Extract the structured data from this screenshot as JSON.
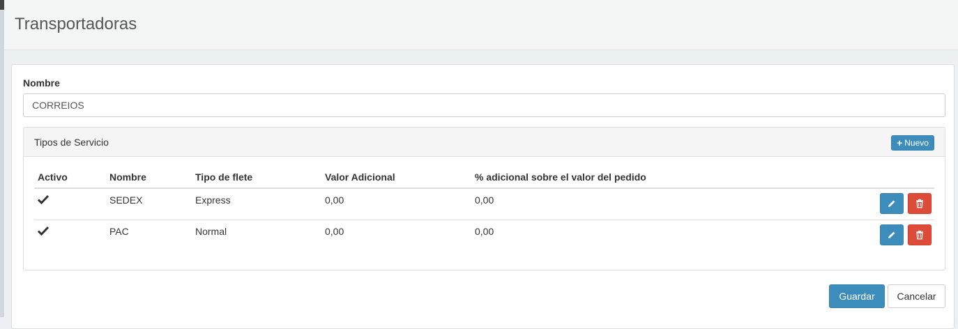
{
  "header": {
    "title": "Transportadoras"
  },
  "form": {
    "name_label": "Nombre",
    "name_value": "CORREIOS"
  },
  "panel": {
    "title": "Tipos de Servicio",
    "new_label": "Nuevo"
  },
  "table": {
    "columns": [
      "Activo",
      "Nombre",
      "Tipo de flete",
      "Valor Adicional",
      "% adicional sobre el valor del pedido"
    ],
    "rows": [
      {
        "active": true,
        "name": "SEDEX",
        "freight_type": "Express",
        "additional_value": "0,00",
        "additional_percent": "0,00"
      },
      {
        "active": true,
        "name": "PAC",
        "freight_type": "Normal",
        "additional_value": "0,00",
        "additional_percent": "0,00"
      }
    ]
  },
  "actions": {
    "save_label": "Guardar",
    "cancel_label": "Cancelar"
  },
  "icons": {
    "check": "check-icon",
    "edit": "pencil-icon",
    "delete": "trash-icon",
    "add": "plus-icon"
  },
  "colors": {
    "primary": "#3c8dbc",
    "danger": "#dd4b39"
  }
}
